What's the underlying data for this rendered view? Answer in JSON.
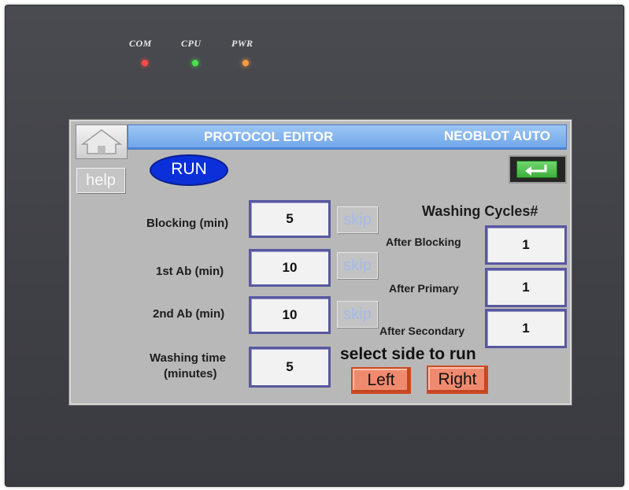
{
  "panel": {
    "leds": [
      {
        "label": "COM",
        "color": "#ff4b4b"
      },
      {
        "label": "CPU",
        "color": "#4be04b"
      },
      {
        "label": "PWR",
        "color": "#ff9a3c"
      }
    ]
  },
  "header": {
    "title": "PROTOCOL EDITOR",
    "mode": "NEOBLOT AUTO"
  },
  "buttons": {
    "help": "help",
    "run": "RUN",
    "skip": "skip",
    "left": "Left",
    "right": "Right"
  },
  "times": [
    {
      "label": "Blocking (min)",
      "value": "5"
    },
    {
      "label": "1st Ab (min)",
      "value": "10"
    },
    {
      "label": "2nd Ab (min)",
      "value": "10"
    },
    {
      "label_line1": "Washing time",
      "label_line2": "(minutes)",
      "value": "5"
    }
  ],
  "washing": {
    "title": "Washing Cycles#",
    "rows": [
      {
        "label": "After Blocking",
        "value": "1"
      },
      {
        "label": "After Primary",
        "value": "1"
      },
      {
        "label": "After Secondary",
        "value": "1"
      }
    ]
  },
  "side": {
    "prompt": "select side to run"
  }
}
